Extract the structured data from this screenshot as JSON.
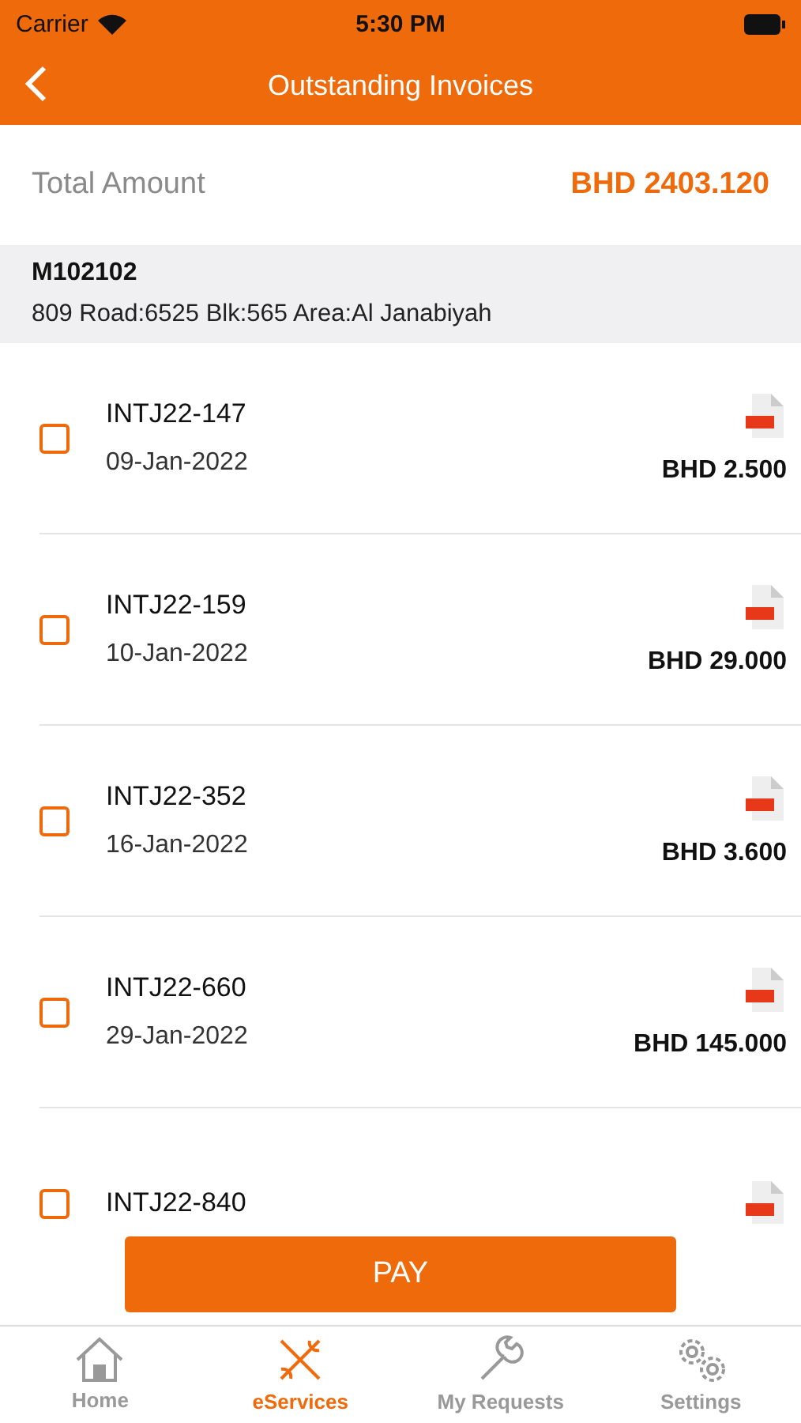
{
  "status_bar": {
    "carrier": "Carrier",
    "time": "5:30 PM"
  },
  "header": {
    "title": "Outstanding Invoices"
  },
  "total": {
    "label": "Total Amount",
    "value": "BHD 2403.120"
  },
  "customer": {
    "id": "M102102",
    "address": "809 Road:6525 Blk:565 Area:Al Janabiyah"
  },
  "invoices": [
    {
      "number": "INTJ22-147",
      "date": "09-Jan-2022",
      "amount": "BHD 2.500",
      "checked": false
    },
    {
      "number": "INTJ22-159",
      "date": "10-Jan-2022",
      "amount": "BHD 29.000",
      "checked": false
    },
    {
      "number": "INTJ22-352",
      "date": "16-Jan-2022",
      "amount": "BHD 3.600",
      "checked": false
    },
    {
      "number": "INTJ22-660",
      "date": "29-Jan-2022",
      "amount": "BHD 145.000",
      "checked": false
    },
    {
      "number": "INTJ22-840",
      "checked": false
    }
  ],
  "pay_button": "PAY",
  "tabs": [
    {
      "kind": "home",
      "label": "Home",
      "selected": false
    },
    {
      "kind": "eservices",
      "label": "eServices",
      "selected": true
    },
    {
      "kind": "requests",
      "label": "My Requests",
      "selected": false
    },
    {
      "kind": "settings",
      "label": "Settings",
      "selected": false
    }
  ]
}
